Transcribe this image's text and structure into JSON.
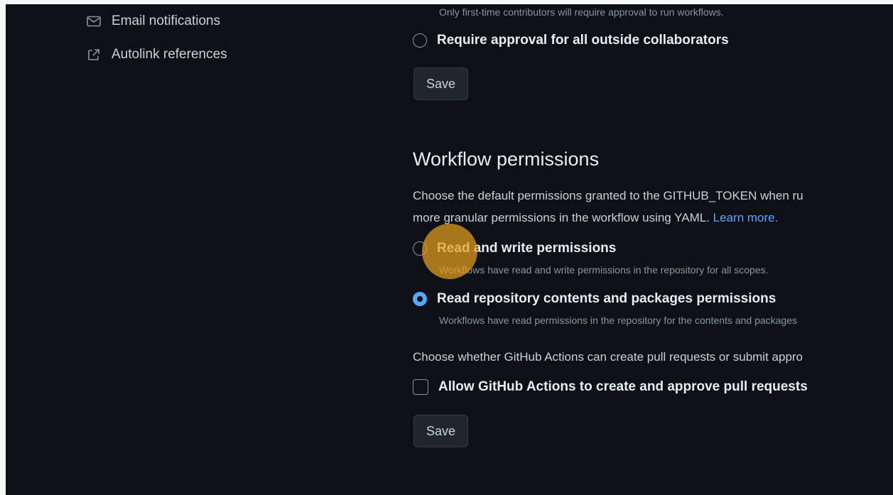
{
  "sidebar": {
    "items": [
      {
        "label": "Email notifications",
        "icon": "mail-icon"
      },
      {
        "label": "Autolink references",
        "icon": "link-external-icon"
      }
    ]
  },
  "fork_approval": {
    "truncated_note": "Only first-time contributors will require approval to run workflows.",
    "option_label": "Require approval for all outside collaborators",
    "save_label": "Save"
  },
  "workflow_permissions": {
    "title": "Workflow permissions",
    "description_line1": "Choose the default permissions granted to the GITHUB_TOKEN when ru",
    "description_line2": "more granular permissions in the workflow using YAML.",
    "learn_more": "Learn more.",
    "options": [
      {
        "label": "Read and write permissions",
        "description": "Workflows have read and write permissions in the repository for all scopes.",
        "checked": false
      },
      {
        "label": "Read repository contents and packages permissions",
        "description": "Workflows have read permissions in the repository for the contents and packages",
        "checked": true
      }
    ],
    "pr_question": "Choose whether GitHub Actions can create pull requests or submit appro",
    "pr_checkbox_label": "Allow GitHub Actions to create and approve pull requests",
    "pr_checkbox_checked": false,
    "save_label": "Save"
  },
  "colors": {
    "background": "#0d1117",
    "accent": "#58a6ff",
    "click_marker": "#e5a01e"
  }
}
